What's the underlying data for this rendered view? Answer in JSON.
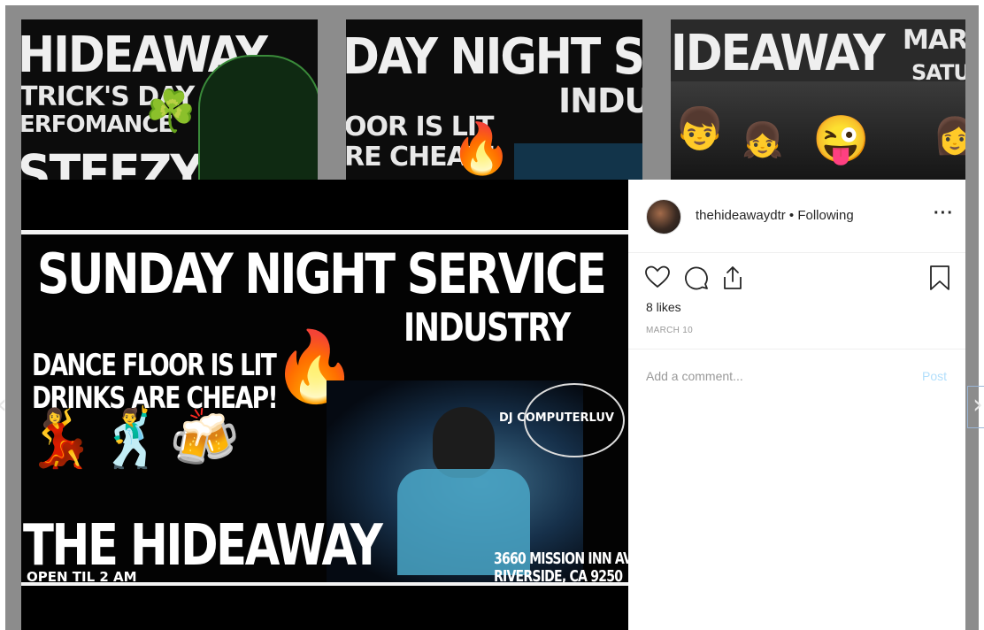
{
  "grid": {
    "tile1": {
      "line1": "HIDEAWAY",
      "line2": "TRICK'S DAY",
      "line3": "ERFOMANCE",
      "line4": "STEEZY"
    },
    "tile2": {
      "line1": "DAY NIGHT SERV",
      "line2": "INDUST",
      "line3": "OOR IS LIT",
      "line4": "RE CHEAP!"
    },
    "tile3": {
      "line1": "IDEAWAY",
      "line2": "MARCH",
      "line3": "SATU"
    }
  },
  "post": {
    "flyer": {
      "headline": "SUNDAY NIGHT SERVICE",
      "subheadline": "INDUSTRY",
      "line1": "DANCE FLOOR IS LIT",
      "line2": "DRINKS ARE CHEAP!",
      "venue": "THE HIDEAWAY",
      "hours": "OPEN TIL 2 AM",
      "dj": "DJ COMPUTERLUV",
      "address1": "3660 MISSION INN AV",
      "address2": "RIVERSIDE, CA 9250"
    }
  },
  "panel": {
    "username": "thehideawaydtr",
    "separator": " • ",
    "follow_status": "Following",
    "more": "···",
    "likes": "8 likes",
    "date": "MARCH 10",
    "comment_placeholder": "Add a comment...",
    "post_label": "Post"
  },
  "nav": {
    "prev": "‹",
    "next": "›"
  }
}
